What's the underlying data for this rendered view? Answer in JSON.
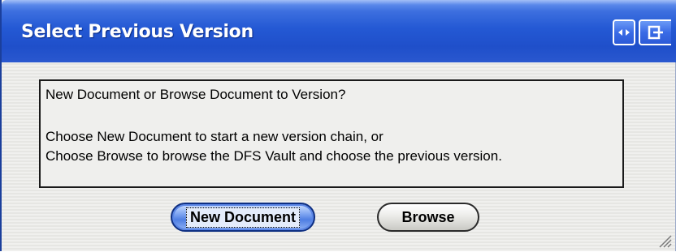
{
  "window": {
    "title": "Select Previous Version",
    "controls": [
      {
        "name": "restore-button",
        "icon": "resize-arrows-icon"
      },
      {
        "name": "exit-button",
        "icon": "exit-door-icon"
      }
    ]
  },
  "message": {
    "question": "New Document or Browse Document to Version?",
    "line1": "Choose New Document to start a new version chain, or",
    "line2": "Choose Browse to browse the DFS Vault and choose the previous version."
  },
  "buttons": {
    "new_document": "New Document",
    "browse": "Browse"
  },
  "colors": {
    "titlebar": "#2459d4",
    "title_text": "#ffffff",
    "primary_button": "#4f7fe3",
    "background": "#ededeb"
  }
}
